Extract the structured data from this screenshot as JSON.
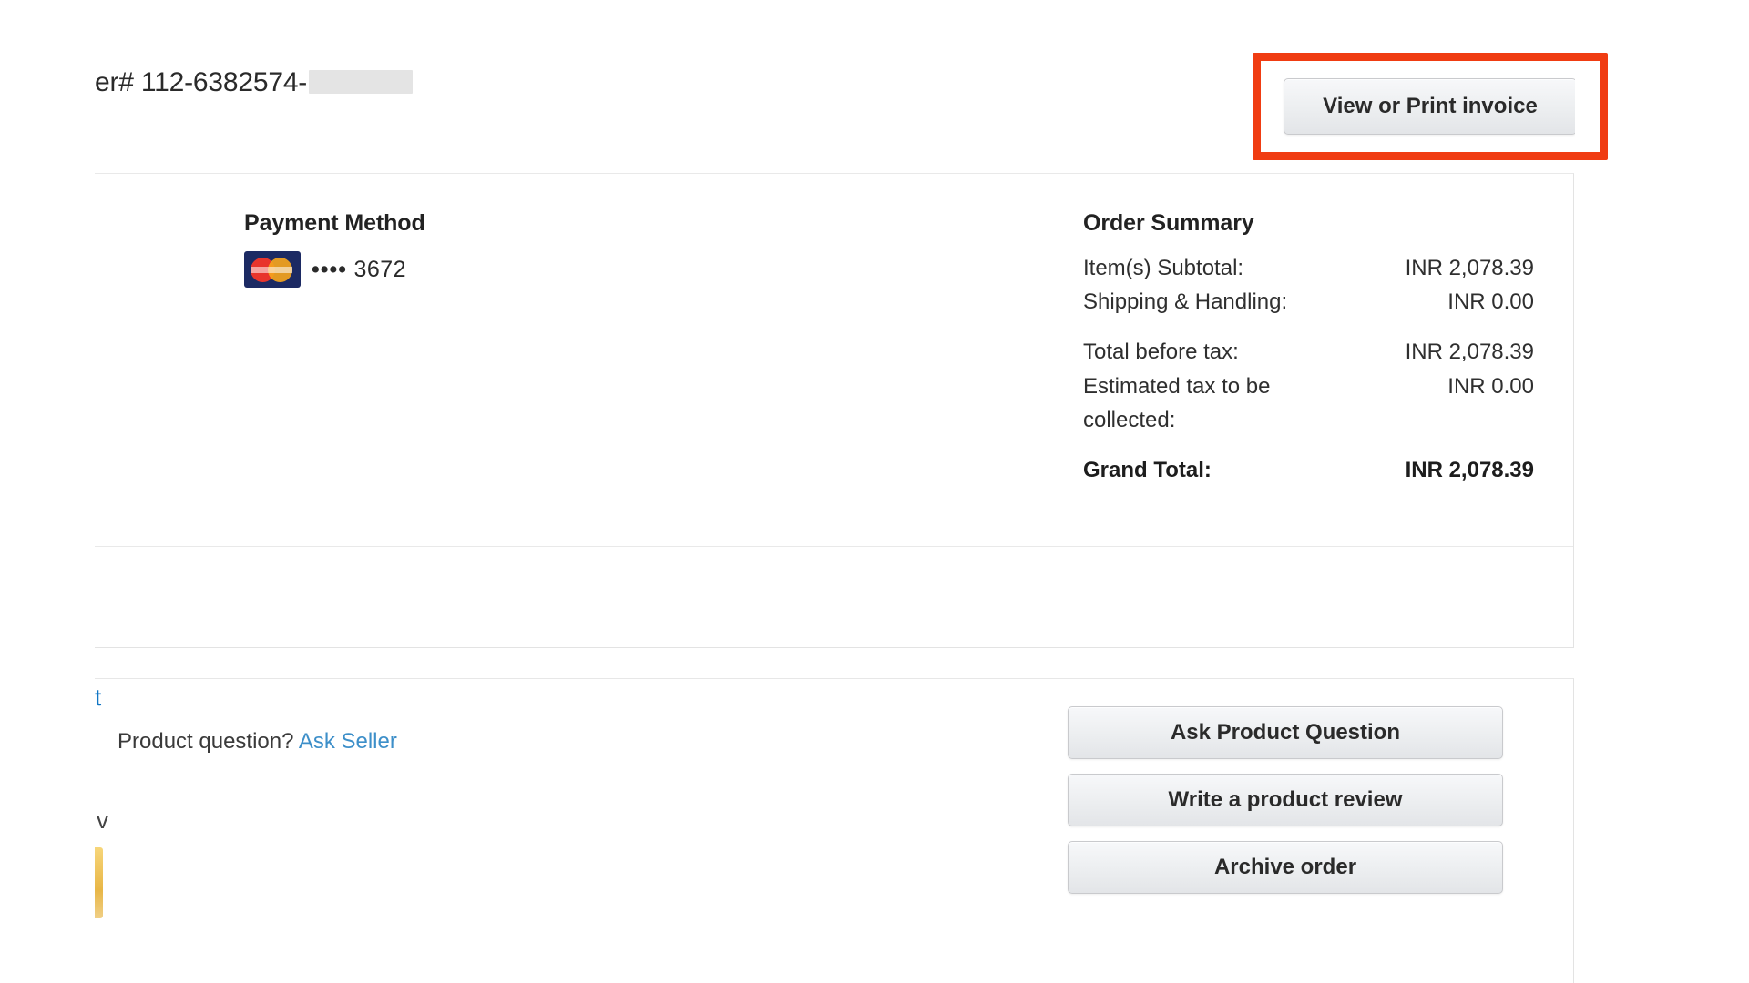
{
  "order": {
    "number_text": "er# 112-6382574-",
    "redacted": true
  },
  "invoice_button": {
    "label": "View or Print invoice",
    "highlight_color": "#f03c12"
  },
  "payment": {
    "heading": "Payment Method",
    "card_icon": "mastercard-icon",
    "masked_prefix": "••••",
    "last_four": "3672"
  },
  "order_summary": {
    "heading": "Order Summary",
    "rows": [
      {
        "label": "Item(s) Subtotal:",
        "value": "INR 2,078.39",
        "bold": false
      },
      {
        "label": "Shipping & Handling:",
        "value": "INR 0.00",
        "bold": false
      },
      {
        "label": "Total before tax:",
        "value": "INR 2,078.39",
        "bold": false
      },
      {
        "label": "Estimated tax to be collected:",
        "value": "INR 0.00",
        "bold": false
      },
      {
        "label": "Grand Total:",
        "value": "INR 2,078.39",
        "bold": true
      }
    ]
  },
  "actions": {
    "stub_link": "t",
    "stub_v": "v",
    "product_question_prefix": "Product question?",
    "ask_seller_link": "Ask Seller",
    "buttons": [
      "Ask Product Question",
      "Write a product review",
      "Archive order"
    ]
  }
}
